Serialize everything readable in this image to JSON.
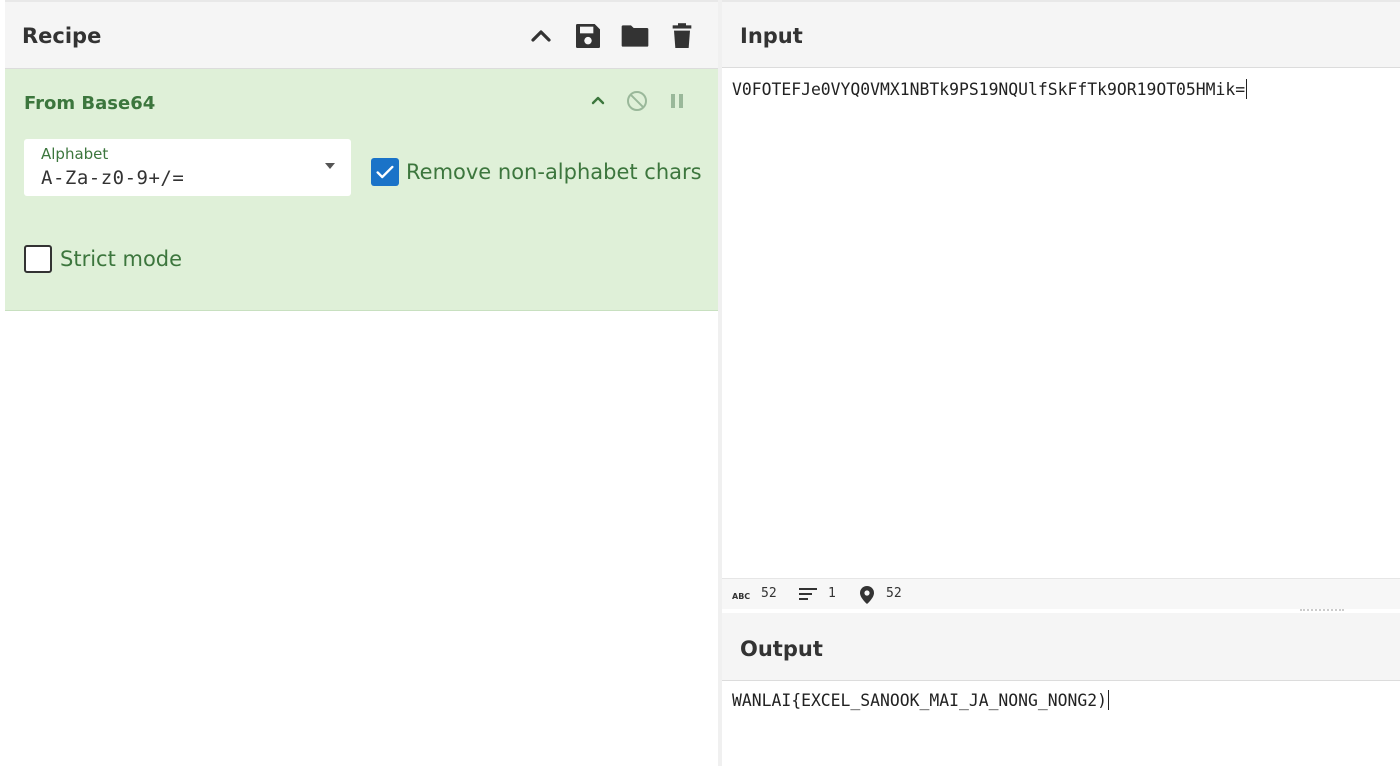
{
  "recipe": {
    "title": "Recipe",
    "icons": [
      "chevron-up-icon",
      "save-icon",
      "folder-icon",
      "trash-icon"
    ]
  },
  "operation": {
    "title": "From Base64",
    "alphabet_label": "Alphabet",
    "alphabet_value": "A-Za-z0-9+/=",
    "remove_non_alphabet_label": "Remove non-alphabet chars",
    "remove_non_alphabet_checked": true,
    "strict_mode_label": "Strict mode",
    "strict_mode_checked": false
  },
  "input": {
    "title": "Input",
    "text": "V0FOTEFJe0VYQ0VMX1NBTk9PS19NQUlfSkFfTk9OR19OT05HMik="
  },
  "status": {
    "length": "52",
    "lines": "1",
    "position": "52"
  },
  "output": {
    "title": "Output",
    "text": "WANLAI{EXCEL_SANOOK_MAI_JA_NONG_NONG2)"
  },
  "colors": {
    "accent_green": "#3c763d",
    "op_background": "#dff0d8",
    "checkbox_blue": "#1a73c8"
  }
}
